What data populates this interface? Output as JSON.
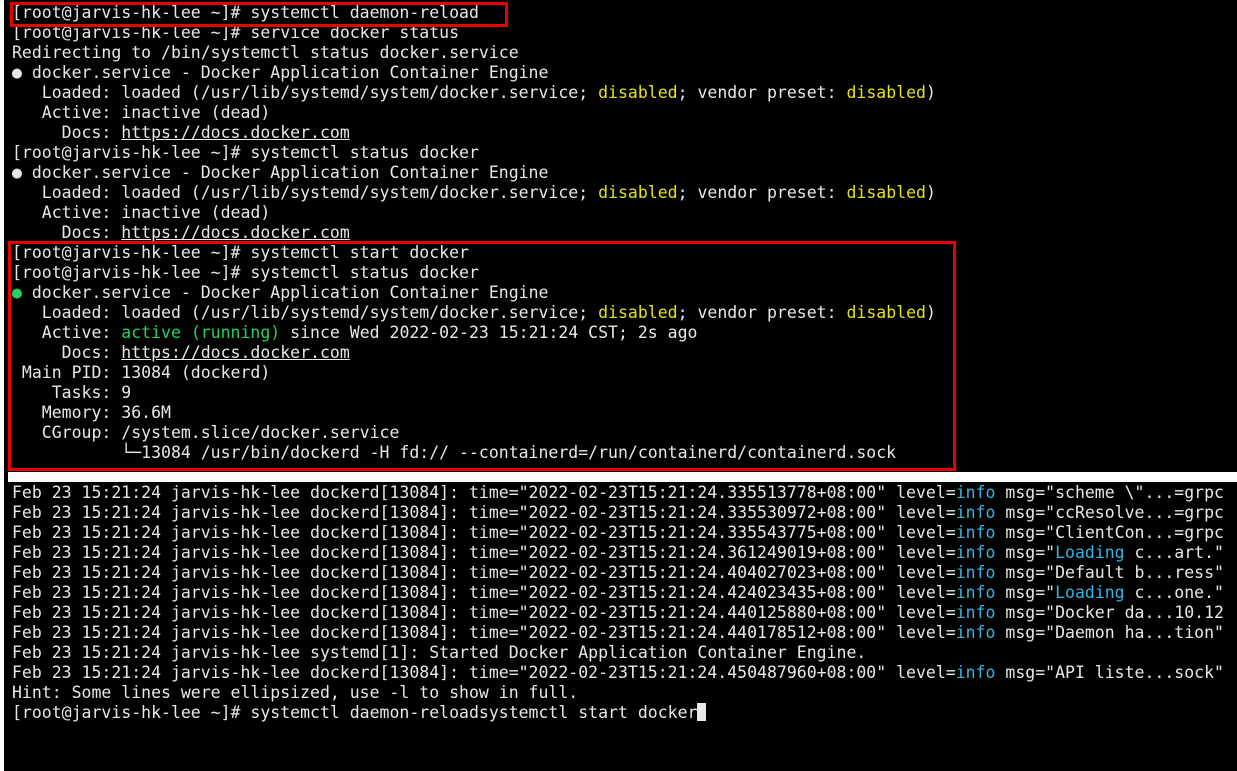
{
  "terminal": {
    "prompt": "[root@jarvis-hk-lee ~]# ",
    "colors": {
      "background": "#000000",
      "text": "#e8e8e8",
      "yellow": "#e5e510",
      "green": "#23d160",
      "cyan": "#33b5e5",
      "highlight_border": "#e60000"
    },
    "lines": [
      {
        "segments": [
          {
            "t": "[root@jarvis-hk-lee ~]# systemctl daemon-reload"
          }
        ]
      },
      {
        "segments": [
          {
            "t": "[root@jarvis-hk-lee ~]# service docker status"
          }
        ]
      },
      {
        "segments": [
          {
            "t": "Redirecting to /bin/systemctl status docker.service"
          }
        ]
      },
      {
        "segments": [
          {
            "t": "● docker.service - Docker Application Container Engine"
          }
        ]
      },
      {
        "segments": [
          {
            "t": "   Loaded: loaded (/usr/lib/systemd/system/docker.service; "
          },
          {
            "t": "disabled",
            "c": "yellow"
          },
          {
            "t": "; vendor preset: "
          },
          {
            "t": "disabled",
            "c": "yellow"
          },
          {
            "t": ")"
          }
        ]
      },
      {
        "segments": [
          {
            "t": "   Active: inactive (dead)"
          }
        ]
      },
      {
        "segments": [
          {
            "t": "     Docs: "
          },
          {
            "t": "https://docs.docker.com",
            "c": "url"
          }
        ]
      },
      {
        "segments": [
          {
            "t": "[root@jarvis-hk-lee ~]# systemctl status docker"
          }
        ]
      },
      {
        "segments": [
          {
            "t": "● docker.service - Docker Application Container Engine"
          }
        ]
      },
      {
        "segments": [
          {
            "t": "   Loaded: loaded (/usr/lib/systemd/system/docker.service; "
          },
          {
            "t": "disabled",
            "c": "yellow"
          },
          {
            "t": "; vendor preset: "
          },
          {
            "t": "disabled",
            "c": "yellow"
          },
          {
            "t": ")"
          }
        ]
      },
      {
        "segments": [
          {
            "t": "   Active: inactive (dead)"
          }
        ]
      },
      {
        "segments": [
          {
            "t": "     Docs: "
          },
          {
            "t": "https://docs.docker.com",
            "c": "url"
          }
        ]
      },
      {
        "segments": [
          {
            "t": "[root@jarvis-hk-lee ~]# systemctl start docker"
          }
        ]
      },
      {
        "segments": [
          {
            "t": "[root@jarvis-hk-lee ~]# systemctl status docker"
          }
        ]
      },
      {
        "segments": [
          {
            "t": "●",
            "c": "green"
          },
          {
            "t": " docker.service - Docker Application Container Engine"
          }
        ]
      },
      {
        "segments": [
          {
            "t": "   Loaded: loaded (/usr/lib/systemd/system/docker.service; "
          },
          {
            "t": "disabled",
            "c": "yellow"
          },
          {
            "t": "; vendor preset: "
          },
          {
            "t": "disabled",
            "c": "yellow"
          },
          {
            "t": ")"
          }
        ]
      },
      {
        "segments": [
          {
            "t": "   Active: "
          },
          {
            "t": "active (running)",
            "c": "green"
          },
          {
            "t": " since Wed 2022-02-23 15:21:24 CST; 2s ago"
          }
        ]
      },
      {
        "segments": [
          {
            "t": "     Docs: "
          },
          {
            "t": "https://docs.docker.com",
            "c": "url"
          }
        ]
      },
      {
        "segments": [
          {
            "t": " Main PID: 13084 (dockerd)"
          }
        ]
      },
      {
        "segments": [
          {
            "t": "    Tasks: 9"
          }
        ]
      },
      {
        "segments": [
          {
            "t": "   Memory: 36.6M"
          }
        ]
      },
      {
        "segments": [
          {
            "t": "   CGroup: /system.slice/docker.service"
          }
        ]
      },
      {
        "segments": [
          {
            "t": "           └─13084 /usr/bin/dockerd -H fd:// --containerd=/run/containerd/containerd.sock"
          }
        ]
      },
      {
        "segments": [
          {
            "t": "Feb 23 15:21:24 jarvis-hk-lee dockerd[13084]: time=\"2022-02-23T15:21:24.335513778+08:00\" level="
          },
          {
            "t": "info",
            "c": "cyan"
          },
          {
            "t": " msg=\"scheme \\\"...=grpc"
          }
        ]
      },
      {
        "segments": [
          {
            "t": "Feb 23 15:21:24 jarvis-hk-lee dockerd[13084]: time=\"2022-02-23T15:21:24.335530972+08:00\" level="
          },
          {
            "t": "info",
            "c": "cyan"
          },
          {
            "t": " msg=\"ccResolve...=grpc"
          }
        ]
      },
      {
        "segments": [
          {
            "t": "Feb 23 15:21:24 jarvis-hk-lee dockerd[13084]: time=\"2022-02-23T15:21:24.335543775+08:00\" level="
          },
          {
            "t": "info",
            "c": "cyan"
          },
          {
            "t": " msg=\"ClientCon...=grpc"
          }
        ]
      },
      {
        "segments": [
          {
            "t": "Feb 23 15:21:24 jarvis-hk-lee dockerd[13084]: time=\"2022-02-23T15:21:24.361249019+08:00\" level="
          },
          {
            "t": "info",
            "c": "cyan"
          },
          {
            "t": " msg=\""
          },
          {
            "t": "Loading",
            "c": "cyan"
          },
          {
            "t": " c...art.\""
          }
        ]
      },
      {
        "segments": [
          {
            "t": "Feb 23 15:21:24 jarvis-hk-lee dockerd[13084]: time=\"2022-02-23T15:21:24.404027023+08:00\" level="
          },
          {
            "t": "info",
            "c": "cyan"
          },
          {
            "t": " msg=\"Default b...ress\""
          }
        ]
      },
      {
        "segments": [
          {
            "t": "Feb 23 15:21:24 jarvis-hk-lee dockerd[13084]: time=\"2022-02-23T15:21:24.424023435+08:00\" level="
          },
          {
            "t": "info",
            "c": "cyan"
          },
          {
            "t": " msg=\""
          },
          {
            "t": "Loading",
            "c": "cyan"
          },
          {
            "t": " c...one.\""
          }
        ]
      },
      {
        "segments": [
          {
            "t": "Feb 23 15:21:24 jarvis-hk-lee dockerd[13084]: time=\"2022-02-23T15:21:24.440125880+08:00\" level="
          },
          {
            "t": "info",
            "c": "cyan"
          },
          {
            "t": " msg=\"Docker da...10.12"
          }
        ]
      },
      {
        "segments": [
          {
            "t": "Feb 23 15:21:24 jarvis-hk-lee dockerd[13084]: time=\"2022-02-23T15:21:24.440178512+08:00\" level="
          },
          {
            "t": "info",
            "c": "cyan"
          },
          {
            "t": " msg=\"Daemon ha...tion\""
          }
        ]
      },
      {
        "segments": [
          {
            "t": "Feb 23 15:21:24 jarvis-hk-lee systemd[1]: Started Docker Application Container Engine."
          }
        ]
      },
      {
        "segments": [
          {
            "t": "Feb 23 15:21:24 jarvis-hk-lee dockerd[13084]: time=\"2022-02-23T15:21:24.450487960+08:00\" level="
          },
          {
            "t": "info",
            "c": "cyan"
          },
          {
            "t": " msg=\"API liste...sock\""
          }
        ]
      },
      {
        "segments": [
          {
            "t": "Hint: Some lines were ellipsized, use -l to show in full."
          }
        ]
      },
      {
        "segments": [
          {
            "t": "[root@jarvis-hk-lee ~]# systemctl daemon-reloadsystemctl start docker"
          }
        ],
        "cursor": true
      }
    ]
  }
}
